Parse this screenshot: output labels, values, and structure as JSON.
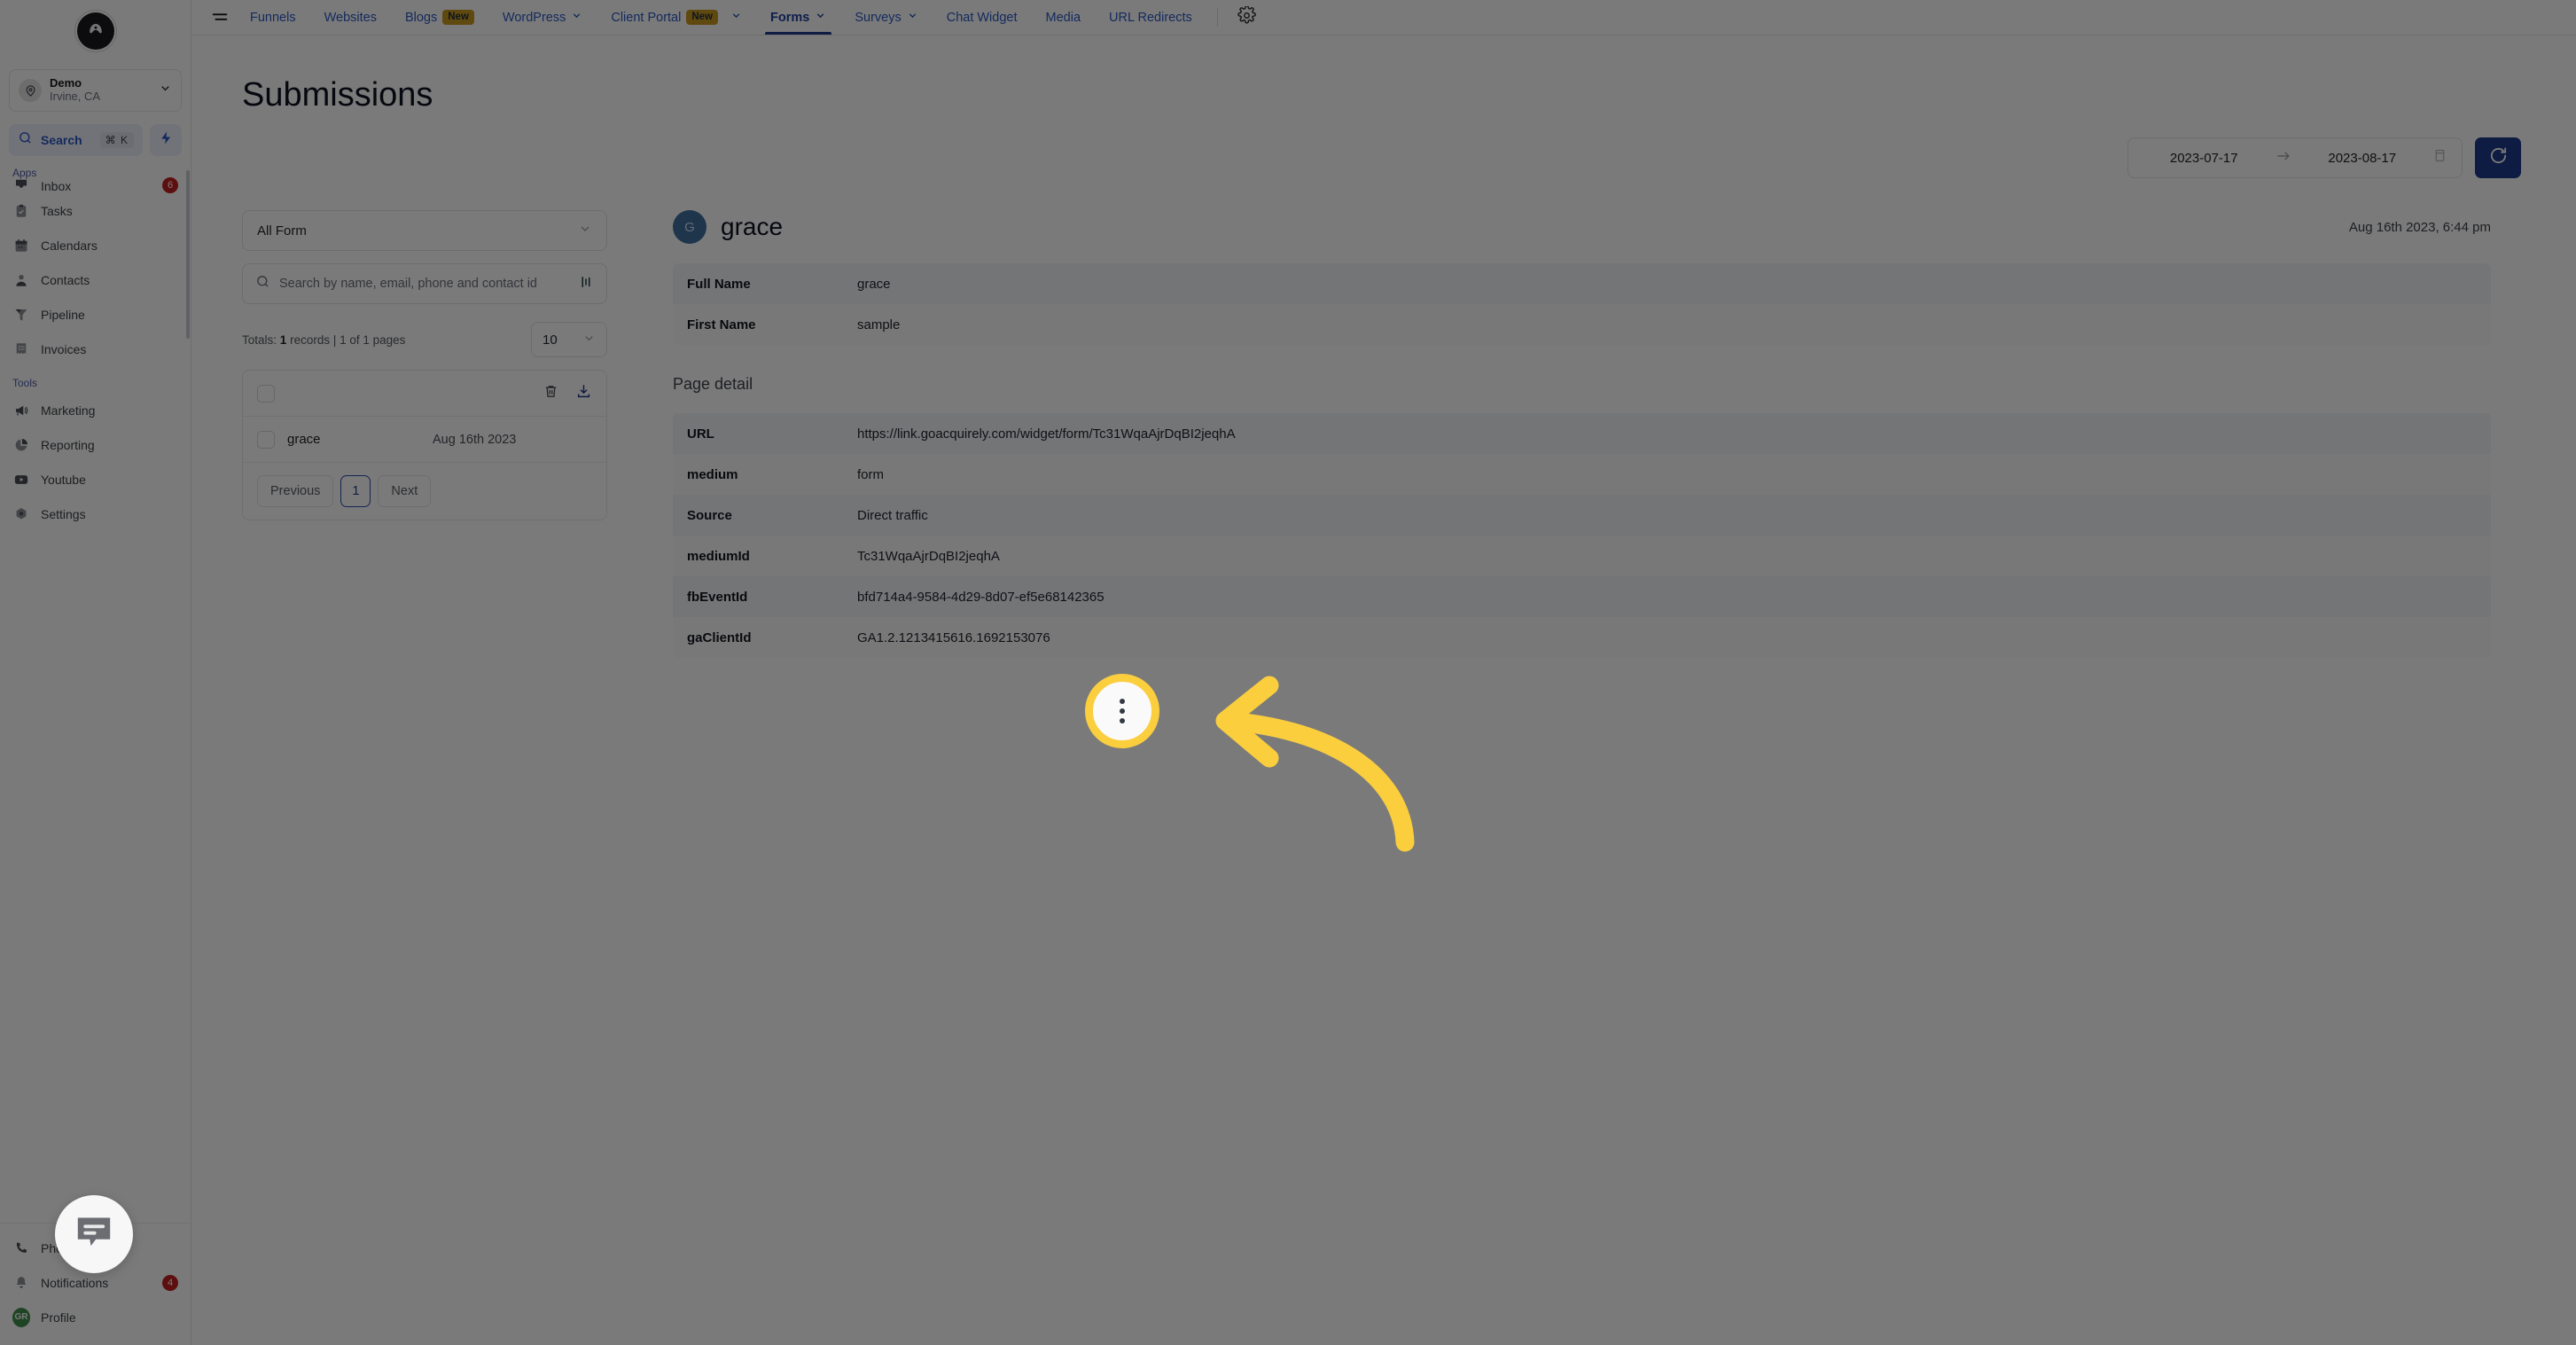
{
  "brand": {
    "logo_letter": "A",
    "accent_blue": "#1e3a8a",
    "link_blue": "#2b59c3",
    "highlight_yellow": "#fbce3e"
  },
  "sidebar": {
    "location": {
      "name": "Demo",
      "sublabel": "Irvine, CA"
    },
    "search": {
      "label": "Search",
      "shortcut": "⌘ K"
    },
    "sections": [
      {
        "label": "Apps",
        "items": [
          {
            "label": "Inbox",
            "icon": "inbox-icon",
            "badge": "6"
          },
          {
            "label": "Tasks",
            "icon": "tasks-icon",
            "badge": ""
          },
          {
            "label": "Calendars",
            "icon": "calendar-icon",
            "badge": ""
          },
          {
            "label": "Contacts",
            "icon": "contacts-icon",
            "badge": ""
          },
          {
            "label": "Pipeline",
            "icon": "pipeline-icon",
            "badge": ""
          },
          {
            "label": "Invoices",
            "icon": "invoices-icon",
            "badge": ""
          }
        ]
      },
      {
        "label": "Tools",
        "items": [
          {
            "label": "Marketing",
            "icon": "megaphone-icon",
            "badge": ""
          },
          {
            "label": "Reporting",
            "icon": "pie-chart-icon",
            "badge": ""
          },
          {
            "label": "Youtube",
            "icon": "youtube-icon",
            "badge": ""
          },
          {
            "label": "Settings",
            "icon": "gear-icon",
            "badge": ""
          }
        ]
      }
    ],
    "bottom_items": [
      {
        "label": "Phone",
        "icon": "phone-icon",
        "badge": ""
      },
      {
        "label": "Notifications",
        "icon": "bell-icon",
        "badge": "4"
      },
      {
        "label": "Profile",
        "icon": "avatar-icon",
        "badge": "",
        "initials": "GR"
      }
    ]
  },
  "topnav": {
    "menu_icon": "hamburger-icon",
    "settings_icon": "gear-icon",
    "tabs": [
      {
        "label": "Funnels",
        "badge": "",
        "caret": false,
        "active": false
      },
      {
        "label": "Websites",
        "badge": "",
        "caret": false,
        "active": false
      },
      {
        "label": "Blogs",
        "badge": "New",
        "caret": false,
        "active": false
      },
      {
        "label": "WordPress",
        "badge": "",
        "caret": true,
        "active": false
      },
      {
        "label": "Client Portal",
        "badge": "New",
        "caret": true,
        "active": false
      },
      {
        "label": "Forms",
        "badge": "",
        "caret": true,
        "active": true
      },
      {
        "label": "Surveys",
        "badge": "",
        "caret": true,
        "active": false
      },
      {
        "label": "Chat Widget",
        "badge": "",
        "caret": false,
        "active": false
      },
      {
        "label": "Media",
        "badge": "",
        "caret": false,
        "active": false
      },
      {
        "label": "URL Redirects",
        "badge": "",
        "caret": false,
        "active": false
      }
    ]
  },
  "page": {
    "title": "Submissions"
  },
  "toolbar": {
    "date_start": "2023-07-17",
    "date_end": "2023-08-17",
    "range_arrow": "→",
    "calendar_icon": "calendar-icon",
    "refresh_icon": "refresh-icon"
  },
  "left_panel": {
    "form_filter": "All Form",
    "search_placeholder": "Search by name, email, phone and contact id",
    "filter_icon": "filter-bars-icon",
    "totals_prefix": "Totals:",
    "totals_count": "1",
    "totals_suffix": "records | 1 of 1 pages",
    "per_page": "10",
    "header_actions": [
      {
        "icon": "trash-icon",
        "name": "delete-selected-button"
      },
      {
        "icon": "download-icon",
        "name": "download-selected-button"
      }
    ],
    "rows": [
      {
        "name": "grace",
        "date": "Aug 16th 2023",
        "menu_icon": "kebab-menu-icon"
      }
    ],
    "pagination": {
      "previous": "Previous",
      "current": "1",
      "next": "Next"
    }
  },
  "detail": {
    "avatar_initial": "G",
    "name": "grace",
    "timestamp": "Aug 16th 2023, 6:44 pm",
    "fields": [
      {
        "key": "Full Name",
        "value": "grace"
      },
      {
        "key": "First Name",
        "value": "sample"
      }
    ],
    "page_detail_label": "Page detail",
    "page_detail": [
      {
        "key": "URL",
        "value": "https://link.goacquirely.com/widget/form/Tc31WqaAjrDqBI2jeqhA"
      },
      {
        "key": "medium",
        "value": "form"
      },
      {
        "key": "Source",
        "value": "Direct traffic"
      },
      {
        "key": "mediumId",
        "value": "Tc31WqaAjrDqBI2jeqhA"
      },
      {
        "key": "fbEventId",
        "value": "bfd714a4-9584-4d29-8d07-ef5e68142365"
      },
      {
        "key": "gaClientId",
        "value": "GA1.2.1213415616.1692153076"
      }
    ]
  },
  "chat_widget": {
    "icon": "chat-bubble-icon"
  }
}
